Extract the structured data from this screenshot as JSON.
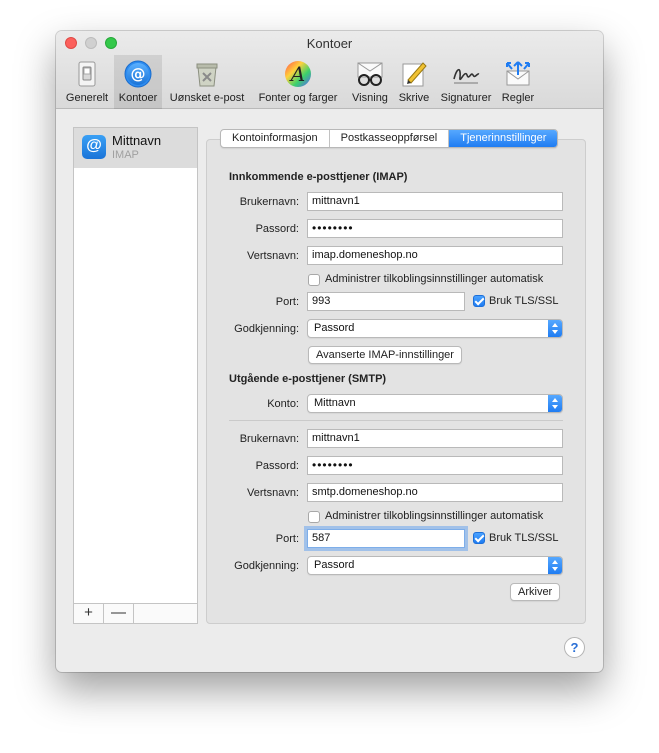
{
  "window": {
    "title": "Kontoer"
  },
  "toolbar": {
    "items": [
      {
        "label": "Generelt",
        "icon": "switch-icon"
      },
      {
        "label": "Kontoer",
        "icon": "at-icon"
      },
      {
        "label": "Uønsket e-post",
        "icon": "junk-mail-icon"
      },
      {
        "label": "Fonter og farger",
        "icon": "font-icon"
      },
      {
        "label": "Visning",
        "icon": "glasses-icon"
      },
      {
        "label": "Skrive",
        "icon": "compose-icon"
      },
      {
        "label": "Signaturer",
        "icon": "signature-icon"
      },
      {
        "label": "Regler",
        "icon": "rules-icon"
      }
    ]
  },
  "sidebar": {
    "account_name": "Mittnavn",
    "account_type": "IMAP",
    "add": "+",
    "remove": "—"
  },
  "tabs": [
    "Kontoinformasjon",
    "Postkasseoppførsel",
    "Tjenerinnstillinger"
  ],
  "incoming": {
    "title": "Innkommende e-posttjener (IMAP)",
    "username_label": "Brukernavn:",
    "username": "mittnavn1",
    "password_label": "Passord:",
    "password": "••••••••",
    "host_label": "Vertsnavn:",
    "host": "imap.domeneshop.no",
    "auto_label": "Administrer tilkoblingsinnstillinger automatisk",
    "port_label": "Port:",
    "port": "993",
    "tls_label": "Bruk TLS/SSL",
    "auth_label": "Godkjenning:",
    "auth": "Passord",
    "advanced": "Avanserte IMAP-innstillinger"
  },
  "outgoing": {
    "title": "Utgående e-posttjener (SMTP)",
    "account_label": "Konto:",
    "account": "Mittnavn",
    "username_label": "Brukernavn:",
    "username": "mittnavn1",
    "password_label": "Passord:",
    "password": "••••••••",
    "host_label": "Vertsnavn:",
    "host": "smtp.domeneshop.no",
    "auto_label": "Administrer tilkoblingsinnstillinger automatisk",
    "port_label": "Port:",
    "port": "587",
    "tls_label": "Bruk TLS/SSL",
    "auth_label": "Godkjenning:",
    "auth": "Passord",
    "archive": "Arkiver"
  },
  "help": "?"
}
